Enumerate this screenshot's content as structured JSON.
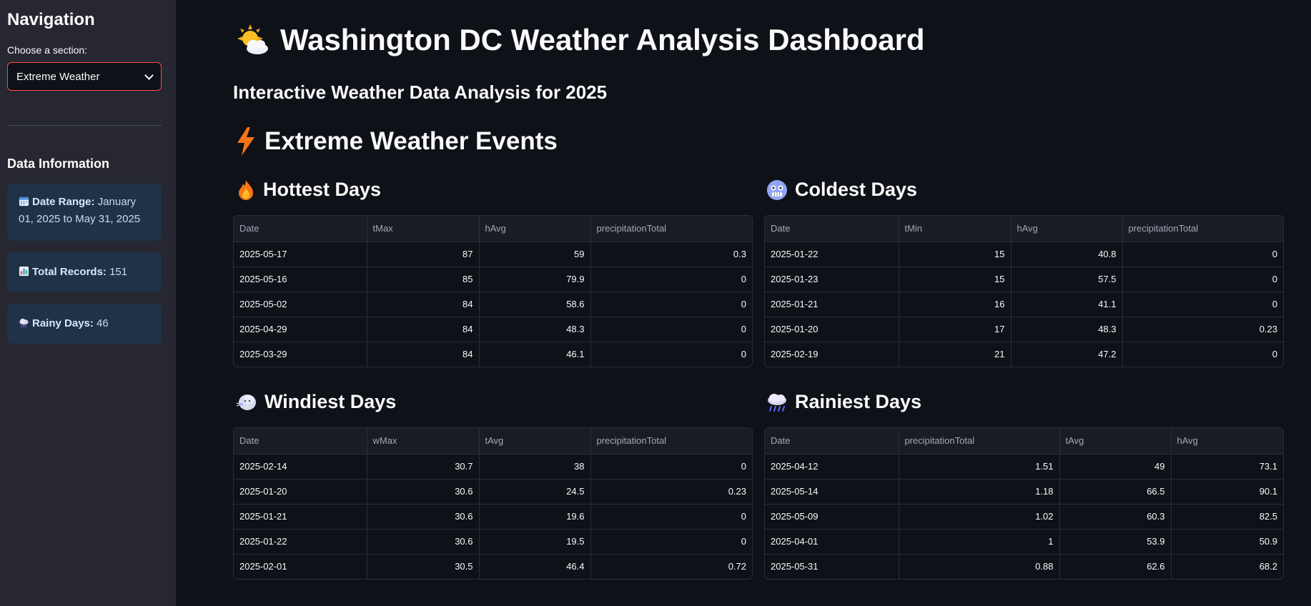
{
  "sidebar": {
    "title": "Navigation",
    "select_label": "Choose a section:",
    "select_value": "Extreme Weather",
    "data_info_title": "Data Information",
    "date_range_label": "Date Range:",
    "date_range_value": "January 01, 2025 to May 31, 2025",
    "total_records_label": "Total Records:",
    "total_records_value": "151",
    "rainy_days_label": "Rainy Days:",
    "rainy_days_value": "46"
  },
  "main": {
    "title": "Washington DC Weather Analysis Dashboard",
    "subtitle": "Interactive Weather Data Analysis for 2025",
    "section_title": "Extreme Weather Events"
  },
  "tables": {
    "hottest": {
      "title": "Hottest Days",
      "headers": [
        "Date",
        "tMax",
        "hAvg",
        "precipitationTotal"
      ],
      "rows": [
        [
          "2025-05-17",
          "87",
          "59",
          "0.3"
        ],
        [
          "2025-05-16",
          "85",
          "79.9",
          "0"
        ],
        [
          "2025-05-02",
          "84",
          "58.6",
          "0"
        ],
        [
          "2025-04-29",
          "84",
          "48.3",
          "0"
        ],
        [
          "2025-03-29",
          "84",
          "46.1",
          "0"
        ]
      ]
    },
    "coldest": {
      "title": "Coldest Days",
      "headers": [
        "Date",
        "tMin",
        "hAvg",
        "precipitationTotal"
      ],
      "rows": [
        [
          "2025-01-22",
          "15",
          "40.8",
          "0"
        ],
        [
          "2025-01-23",
          "15",
          "57.5",
          "0"
        ],
        [
          "2025-01-21",
          "16",
          "41.1",
          "0"
        ],
        [
          "2025-01-20",
          "17",
          "48.3",
          "0.23"
        ],
        [
          "2025-02-19",
          "21",
          "47.2",
          "0"
        ]
      ]
    },
    "windiest": {
      "title": "Windiest Days",
      "headers": [
        "Date",
        "wMax",
        "tAvg",
        "precipitationTotal"
      ],
      "rows": [
        [
          "2025-02-14",
          "30.7",
          "38",
          "0"
        ],
        [
          "2025-01-20",
          "30.6",
          "24.5",
          "0.23"
        ],
        [
          "2025-01-21",
          "30.6",
          "19.6",
          "0"
        ],
        [
          "2025-01-22",
          "30.6",
          "19.5",
          "0"
        ],
        [
          "2025-02-01",
          "30.5",
          "46.4",
          "0.72"
        ]
      ]
    },
    "rainiest": {
      "title": "Rainiest Days",
      "headers": [
        "Date",
        "precipitationTotal",
        "tAvg",
        "hAvg"
      ],
      "rows": [
        [
          "2025-04-12",
          "1.51",
          "49",
          "73.1"
        ],
        [
          "2025-05-14",
          "1.18",
          "66.5",
          "90.1"
        ],
        [
          "2025-05-09",
          "1.02",
          "60.3",
          "82.5"
        ],
        [
          "2025-04-01",
          "1",
          "53.9",
          "50.9"
        ],
        [
          "2025-05-31",
          "0.88",
          "62.6",
          "68.2"
        ]
      ]
    }
  },
  "icons": {
    "title": "sun-behind-cloud-icon",
    "section": "lightning-icon",
    "hottest": "fire-icon",
    "coldest": "cold-face-icon",
    "windiest": "wind-face-icon",
    "rainiest": "rain-cloud-icon",
    "date_range": "calendar-icon",
    "total_records": "bar-chart-icon",
    "rainy_days": "rain-cloud-icon"
  },
  "colors": {
    "accent": "#ff4b4b",
    "sidebar_bg": "#262730",
    "page_bg": "#0e1117",
    "info_card_bg": "#1f3247"
  }
}
